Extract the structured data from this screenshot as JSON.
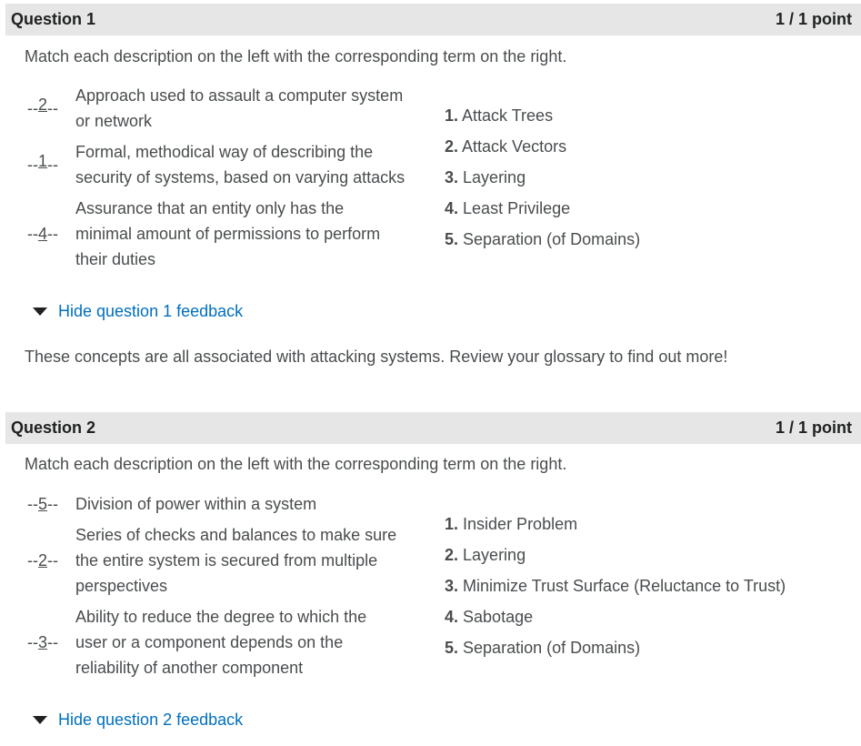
{
  "questions": [
    {
      "title": "Question 1",
      "points": "1 / 1 point",
      "prompt": "Match each description on the left with the corresponding term on the right.",
      "rows": [
        {
          "answer": "2",
          "lines": [
            "Approach used to assault a computer system",
            "or network"
          ]
        },
        {
          "answer": "1",
          "lines": [
            "Formal, methodical way of describing the",
            "security of systems, based on varying attacks"
          ]
        },
        {
          "answer": "4",
          "lines": [
            "Assurance that an entity only has the",
            "minimal amount of permissions to perform",
            "their duties"
          ]
        }
      ],
      "terms": [
        {
          "num": "1.",
          "label": "Attack Trees"
        },
        {
          "num": "2.",
          "label": "Attack Vectors"
        },
        {
          "num": "3.",
          "label": "Layering"
        },
        {
          "num": "4.",
          "label": "Least Privilege"
        },
        {
          "num": "5.",
          "label": "Separation (of Domains)"
        }
      ],
      "feedback_toggle": "Hide question 1 feedback",
      "feedback": "These concepts are all associated with attacking systems. Review your glossary to find out more!"
    },
    {
      "title": "Question 2",
      "points": "1 / 1 point",
      "prompt": "Match each description on the left with the corresponding term on the right.",
      "rows": [
        {
          "answer": "5",
          "lines": [
            "Division of power within a system"
          ]
        },
        {
          "answer": "2",
          "lines": [
            "Series of checks and balances to make sure",
            "the entire system is secured from multiple",
            "perspectives"
          ]
        },
        {
          "answer": "3",
          "lines": [
            "Ability to reduce the degree to which the",
            "user or a component depends on the",
            "reliability of another component"
          ]
        }
      ],
      "terms": [
        {
          "num": "1.",
          "label": "Insider Problem"
        },
        {
          "num": "2.",
          "label": "Layering"
        },
        {
          "num": "3.",
          "label": "Minimize Trust Surface (Reluctance to Trust)"
        },
        {
          "num": "4.",
          "label": "Sabotage"
        },
        {
          "num": "5.",
          "label": "Separation (of Domains)"
        }
      ],
      "feedback_toggle": "Hide question 2 feedback"
    }
  ]
}
